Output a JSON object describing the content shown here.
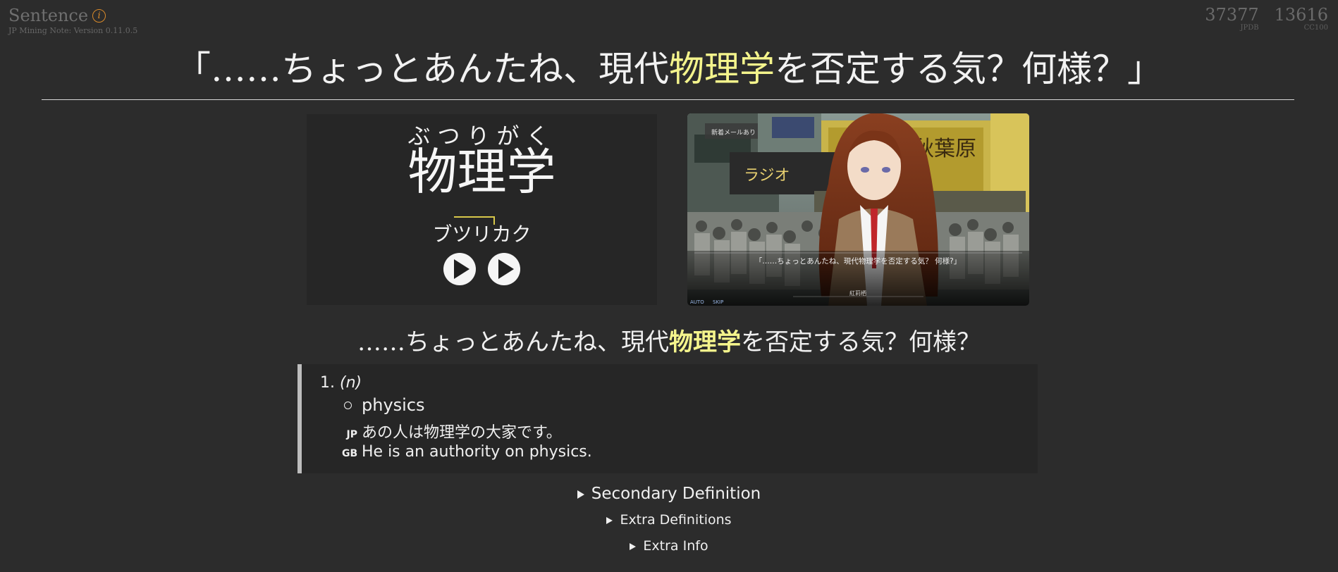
{
  "card": {
    "type_label": "Sentence",
    "info_icon": "info-icon",
    "version": "JP Mining Note: Version 0.11.0.5"
  },
  "frequencies": [
    {
      "value": "37377",
      "name": "JPDB"
    },
    {
      "value": "13616",
      "name": "CC100"
    }
  ],
  "sentence": {
    "before": "「……ちょっとあんたね、現代",
    "highlight": "物理学",
    "after": "を否定する気？何様？」"
  },
  "word": {
    "furigana": "ぶつりがく",
    "kanji": "物理学",
    "reading_a": "ブ",
    "reading_b": "ツリ",
    "reading_c": "カ",
    "reading_d": "ク",
    "pitch_accent_color": "#d8c84a",
    "audio_buttons": [
      "play-icon",
      "play-icon"
    ]
  },
  "screenshot": {
    "dialogue": "「……ちょっとあんたね、現代物理学を否定する気？ 何様?」",
    "speaker": "紅莉栖",
    "mail_notice": "新着メールあり",
    "auto_label": "AUTO",
    "skip_label": "SKIP"
  },
  "sentence_plain": {
    "before": "……ちょっとあんたね、現代",
    "highlight": "物理学",
    "after": "を否定する気？何様？"
  },
  "definition": {
    "number": "1.",
    "pos": "(n)",
    "gloss": "physics",
    "examples": [
      {
        "tag": "JP",
        "text": "あの人は物理学の大家です。"
      },
      {
        "tag": "GB",
        "text": "He is an authority on physics."
      }
    ]
  },
  "sections": {
    "secondary": "Secondary Definition",
    "extra_defs": "Extra Definitions",
    "extra_info": "Extra Info"
  },
  "colors": {
    "background": "#2c2c2c",
    "highlight": "#f4f48c",
    "info_icon": "#d98a2a"
  }
}
